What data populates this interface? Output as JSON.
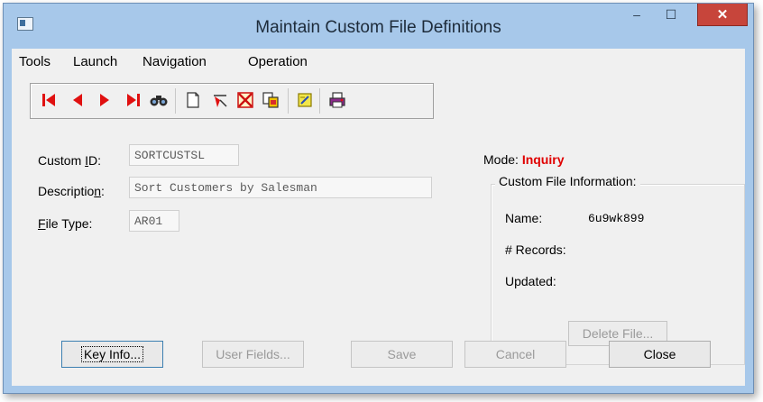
{
  "window": {
    "title": "Maintain Custom File Definitions",
    "minimize_glyph": "‒",
    "maximize_glyph": "☐",
    "close_glyph": "✕"
  },
  "menu": [
    "Tools",
    "Launch",
    "Navigation",
    "Operation"
  ],
  "toolbar": {
    "buttons": [
      "first-record-icon",
      "previous-record-icon",
      "next-record-icon",
      "last-record-icon",
      "find-icon",
      "new-document-icon",
      "clear-icon",
      "delete-icon",
      "copy-icon",
      "notes-icon",
      "print-icon"
    ]
  },
  "form": {
    "custom_id": {
      "label_u": "I",
      "label_pre": "Custom ",
      "label_post": "D:",
      "value": "SORTCUSTSL"
    },
    "description": {
      "label_pre": "Descriptio",
      "label_u": "n",
      "label_post": ":",
      "value": "Sort Customers by Salesman"
    },
    "file_type": {
      "label_u": "F",
      "label_post": "ile Type:",
      "value": "AR01"
    }
  },
  "mode": {
    "label": "Mode: ",
    "value": "Inquiry"
  },
  "custom_file_info": {
    "title": "Custom File Information:",
    "name_label": "Name:",
    "name_value": "6u9wk899",
    "records_label": "# Records:",
    "updated_label": "Updated:",
    "delete_button": "Delete File..."
  },
  "buttons": {
    "key_info": "Key Info...",
    "user_fields": "User Fields...",
    "save": "Save",
    "cancel": "Cancel",
    "close": "Close"
  },
  "colors": {
    "accent_red": "#e00000",
    "title_bar": "#a7c8ea",
    "close_red": "#c7453b"
  }
}
